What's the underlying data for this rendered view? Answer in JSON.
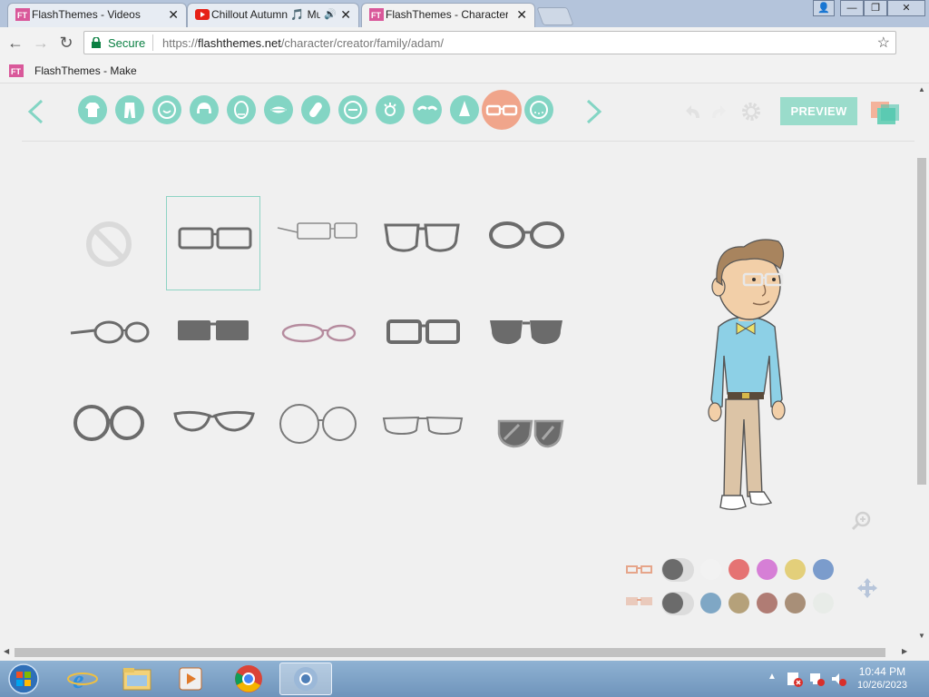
{
  "browser": {
    "tabs": [
      {
        "title": "FlashThemes - Videos",
        "active": false
      },
      {
        "title": "Chillout Autumn 🎵 Mu",
        "active": false,
        "audio": true
      },
      {
        "title": "FlashThemes - Character",
        "active": true
      }
    ],
    "address": {
      "secure_label": "Secure",
      "url_prefix": "https://",
      "url_host": "flashthemes.net",
      "url_path": "/character/creator/family/adam/"
    },
    "bookmarks": [
      {
        "title": "FlashThemes - Make"
      }
    ]
  },
  "creator": {
    "preview_label": "PREVIEW",
    "categories": [
      "shirt",
      "pants",
      "skin",
      "hair",
      "face-shape",
      "mouth",
      "accessory",
      "ear",
      "eye",
      "eyebrow",
      "nose",
      "glasses",
      "facial-hair"
    ],
    "selected_category": "glasses",
    "glasses_options": [
      "none",
      "rectangular",
      "thin-wire",
      "bold-rounded",
      "oval-thick",
      "side-temple",
      "black-sunglasses",
      "pink-oval",
      "bold-rectangle",
      "dark-sunglasses",
      "round-thick",
      "cat-eye",
      "large-round",
      "wire-rectangle",
      "aviator-shades"
    ],
    "selected_option": "rectangular",
    "color_rows": [
      {
        "icon": "frame-color-icon",
        "current": "#6b6b6b",
        "swatches": [
          "#f2f2f2",
          "#e57373",
          "#d67fd6",
          "#e3cf7a",
          "#7b9ccc"
        ]
      },
      {
        "icon": "lens-color-icon",
        "current": "#6b6b6b",
        "swatches": [
          "#7fa7c5",
          "#b5a17a",
          "#b07c74",
          "#a88f78",
          "#e8ece8"
        ]
      }
    ]
  },
  "taskbar": {
    "time": "10:44 PM",
    "date": "10/26/2023"
  }
}
